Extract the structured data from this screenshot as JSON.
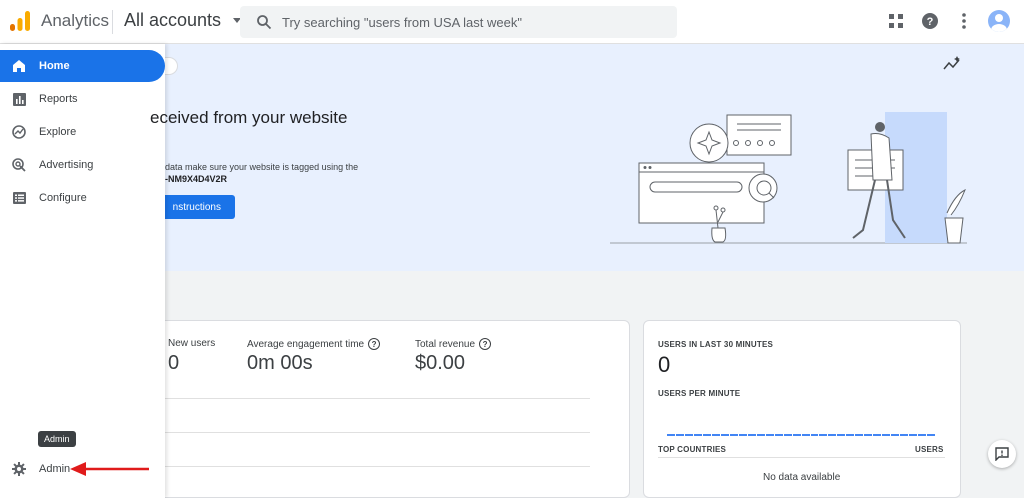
{
  "header": {
    "app_title": "Analytics",
    "account_selector": "All accounts",
    "search_placeholder": "Try searching \"users from USA last week\""
  },
  "sidebar": {
    "items": [
      {
        "label": "Home",
        "icon": "home-icon",
        "active": true
      },
      {
        "label": "Reports",
        "icon": "reports-icon"
      },
      {
        "label": "Explore",
        "icon": "explore-icon"
      },
      {
        "label": "Advertising",
        "icon": "advertising-icon"
      },
      {
        "label": "Configure",
        "icon": "configure-icon"
      }
    ],
    "admin_label": "Admin",
    "admin_tooltip": "Admin"
  },
  "banner": {
    "title": "eceived from your website",
    "text": "data make sure your website is tagged using the",
    "tag_id": "-NM9X4D4V2R",
    "button_label": "nstructions"
  },
  "metrics": [
    {
      "label": "New users",
      "value": "0",
      "help": false
    },
    {
      "label": "Average engagement time",
      "value": "0m 00s",
      "help": true
    },
    {
      "label": "Total revenue",
      "value": "$0.00",
      "help": true
    }
  ],
  "realtime": {
    "users_label": "USERS IN LAST 30 MINUTES",
    "users_value": "0",
    "per_minute_label": "USERS PER MINUTE",
    "countries_label": "TOP COUNTRIES",
    "users_col_label": "USERS",
    "no_data": "No data available"
  },
  "colors": {
    "accent": "#1a73e8",
    "banner_bg": "#e8f0fe",
    "logo_orange": "#f9ab00",
    "logo_dark": "#e37400",
    "arrow_red": "#e01b1b"
  }
}
